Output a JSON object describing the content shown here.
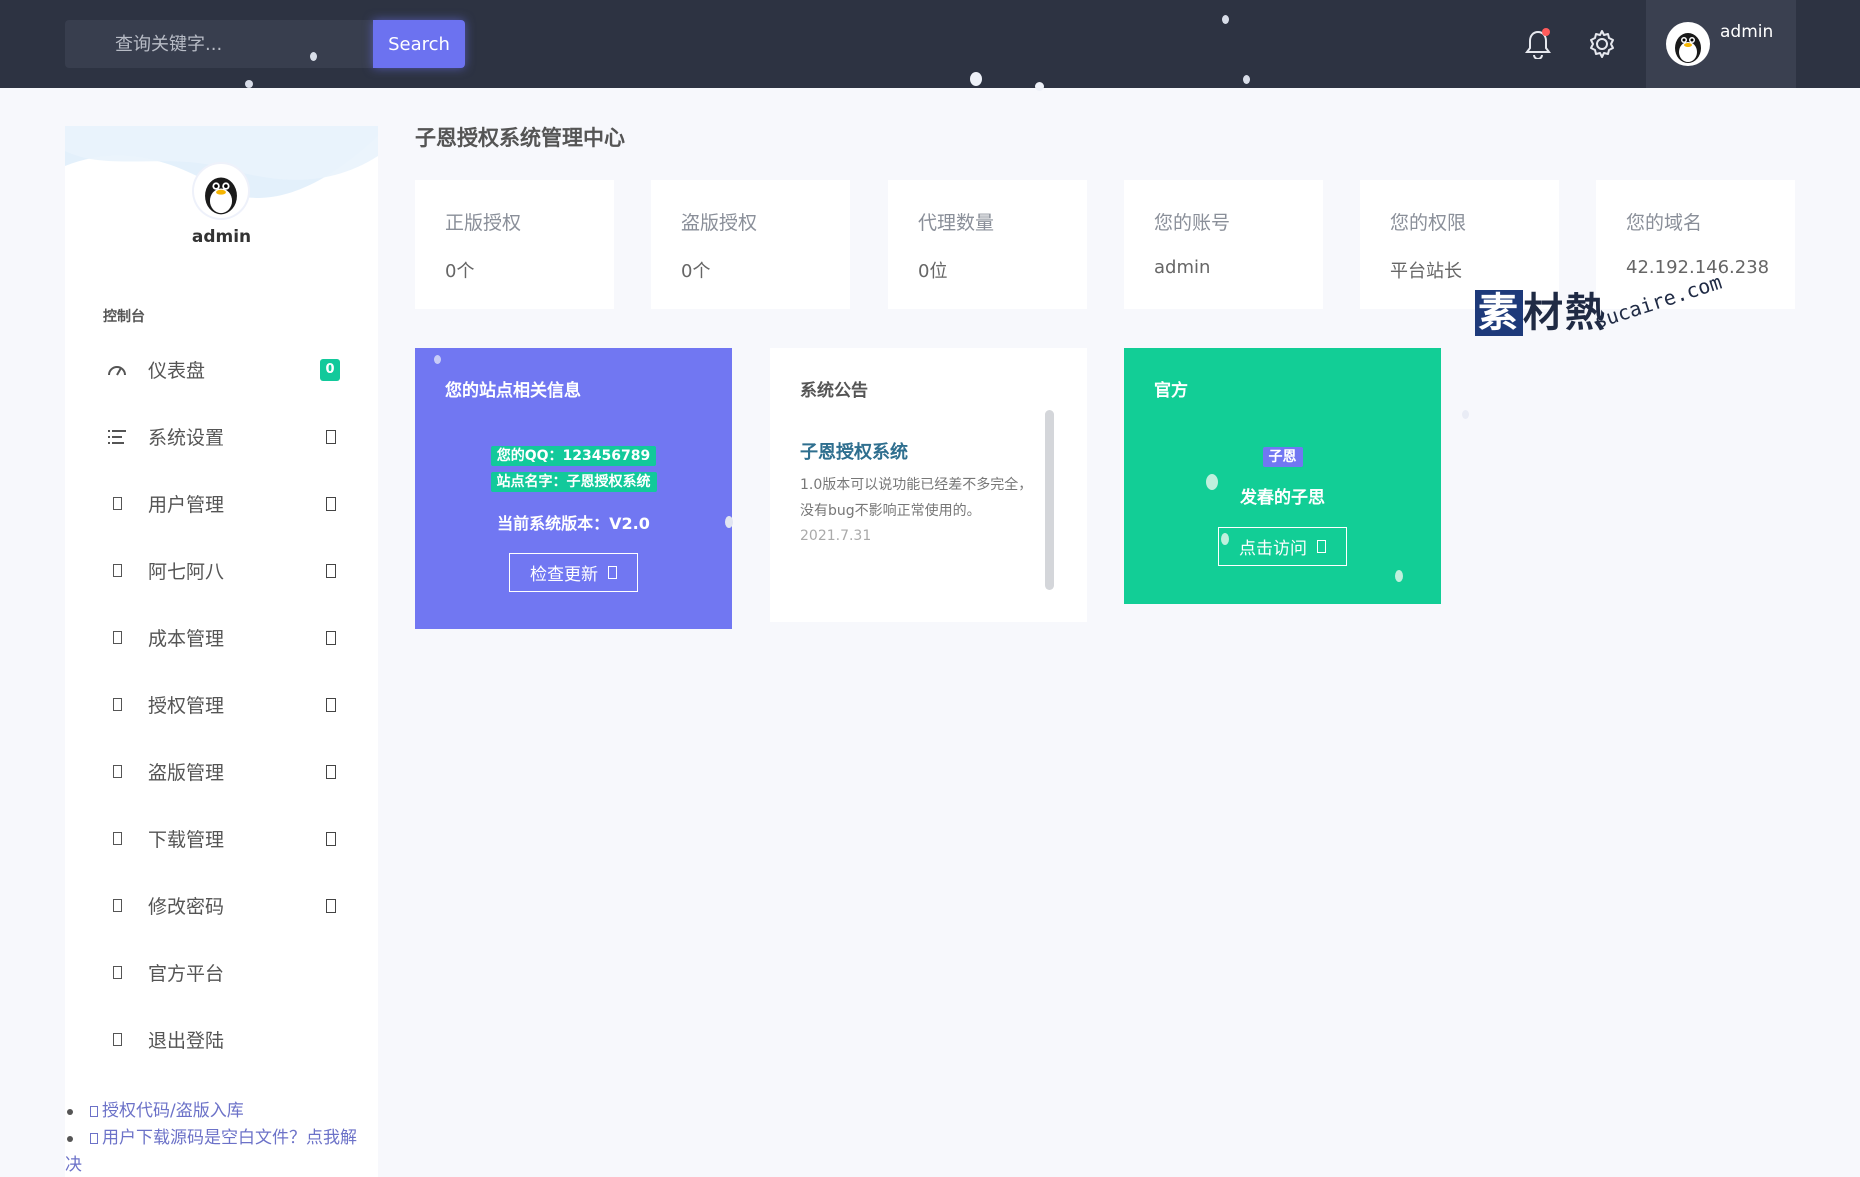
{
  "topbar": {
    "search_placeholder": "查询关键字...",
    "search_button": "Search",
    "user_name": "admin"
  },
  "sidebar": {
    "user_name": "admin",
    "section_title": "控制台",
    "items": [
      {
        "label": "仪表盘",
        "icon": "gauge-icon",
        "badge": "0"
      },
      {
        "label": "系统设置",
        "icon": "list-icon"
      },
      {
        "label": "用户管理",
        "icon": "box-icon"
      },
      {
        "label": "阿七阿八",
        "icon": "box-icon"
      },
      {
        "label": "成本管理",
        "icon": "box-icon"
      },
      {
        "label": "授权管理",
        "icon": "box-icon"
      },
      {
        "label": "盗版管理",
        "icon": "box-icon"
      },
      {
        "label": "下载管理",
        "icon": "box-icon"
      },
      {
        "label": "修改密码",
        "icon": "box-icon"
      },
      {
        "label": "官方平台",
        "icon": "box-icon"
      },
      {
        "label": "退出登陆",
        "icon": "box-icon"
      }
    ],
    "links": [
      "授权代码/盗版入库",
      "用户下载源码是空白文件？点我解",
      "决"
    ]
  },
  "main": {
    "page_title": "子恩授权系统管理中心",
    "stats": [
      {
        "label": "正版授权",
        "value": "0个"
      },
      {
        "label": "盗版授权",
        "value": "0个"
      },
      {
        "label": "代理数量",
        "value": "0位"
      },
      {
        "label": "您的账号",
        "value": "admin"
      },
      {
        "label": "您的权限",
        "value": "平台站长"
      },
      {
        "label": "您的域名",
        "value": "42.192.146.238"
      }
    ],
    "site_panel": {
      "title": "您的站点相关信息",
      "qq": "您的QQ：123456789",
      "site_name": "站点名字：子恩授权系统",
      "version": "当前系统版本：V2.0",
      "button": "检查更新"
    },
    "notice_panel": {
      "title": "系统公告",
      "notice_title": "子恩授权系统",
      "notice_body": "1.0版本可以说功能已经差不多完全，没有bug不影响正常使用的。",
      "notice_date": "2021.7.31"
    },
    "official_panel": {
      "title": "官方",
      "tag": "子恩",
      "motto": "发春的子思",
      "button": "点击访问"
    }
  },
  "watermark": {
    "main": "素材熱",
    "sub": "sucaire.com"
  },
  "colors": {
    "topbar": "#2d3342",
    "accent": "#7177f2",
    "green": "#12ce96",
    "badge": "#12c99b"
  }
}
